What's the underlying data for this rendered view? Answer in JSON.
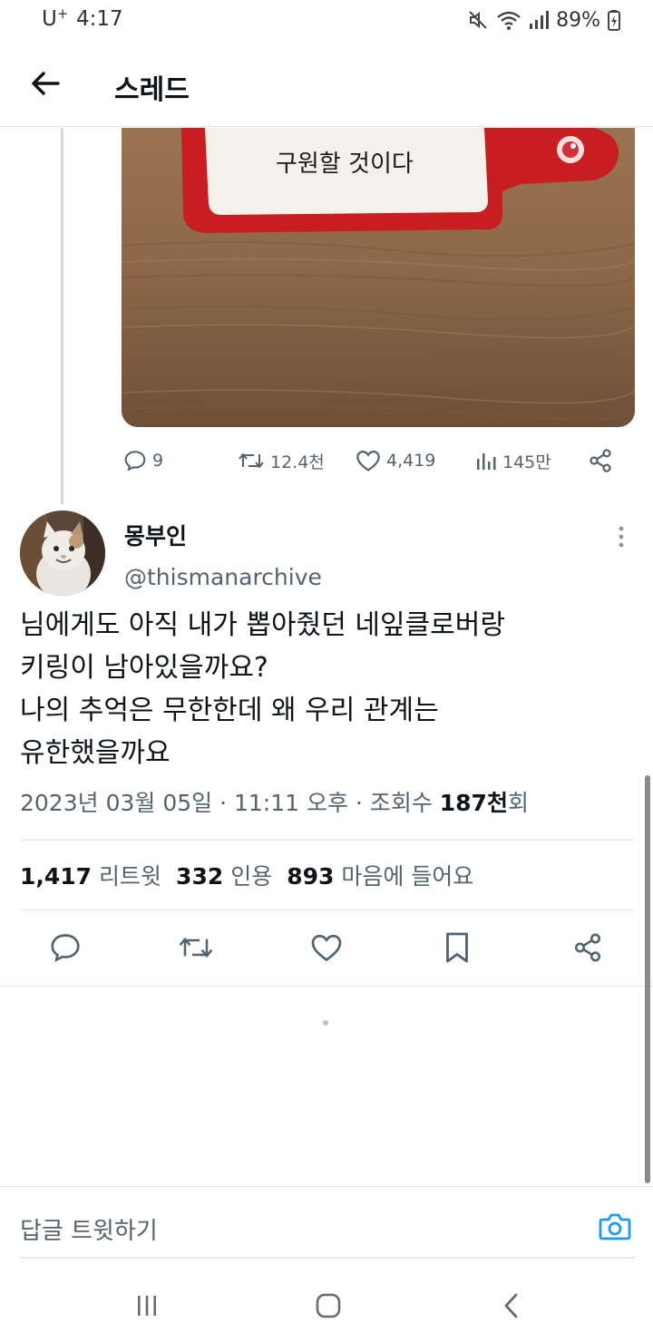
{
  "status_bar": {
    "carrier": "U",
    "carrier_sup": "+",
    "time": "4:17",
    "battery": "89%",
    "icons": [
      "mute-icon",
      "wifi-icon",
      "signal-icon",
      "battery-charging-icon"
    ]
  },
  "header": {
    "back_icon": "arrow-left-icon",
    "title": "스레드"
  },
  "parent_tweet": {
    "image_text": "구원할 것이다",
    "actions": {
      "replies": "9",
      "retweets": "12.4천",
      "likes": "4,419",
      "views": "145만"
    }
  },
  "tweet": {
    "author_name": "몽부인",
    "author_handle": "@thismanarchive",
    "lines": [
      "님에게도 아직 내가 뽑아줬던 네잎클로버랑",
      "키링이 남아있을까요?",
      "나의 추억은 무한한데 왜 우리 관계는",
      "유한했을까요"
    ],
    "meta_prefix": "2023년 03월 05일 · 11:11 오후 · 조회수 ",
    "views_num": "187천",
    "views_suffix": "회",
    "stats": {
      "retweets_num": "1,417",
      "retweets_label": "리트윗",
      "quotes_num": "332",
      "quotes_label": "인용",
      "likes_num": "893",
      "likes_label": "마음에 들어요"
    }
  },
  "reply_bar": {
    "placeholder": "답글 트윗하기"
  },
  "colors": {
    "text_primary": "#0f1419",
    "text_secondary": "#536471",
    "accent": "#1d9bf0",
    "divider": "#e6e9ec"
  }
}
